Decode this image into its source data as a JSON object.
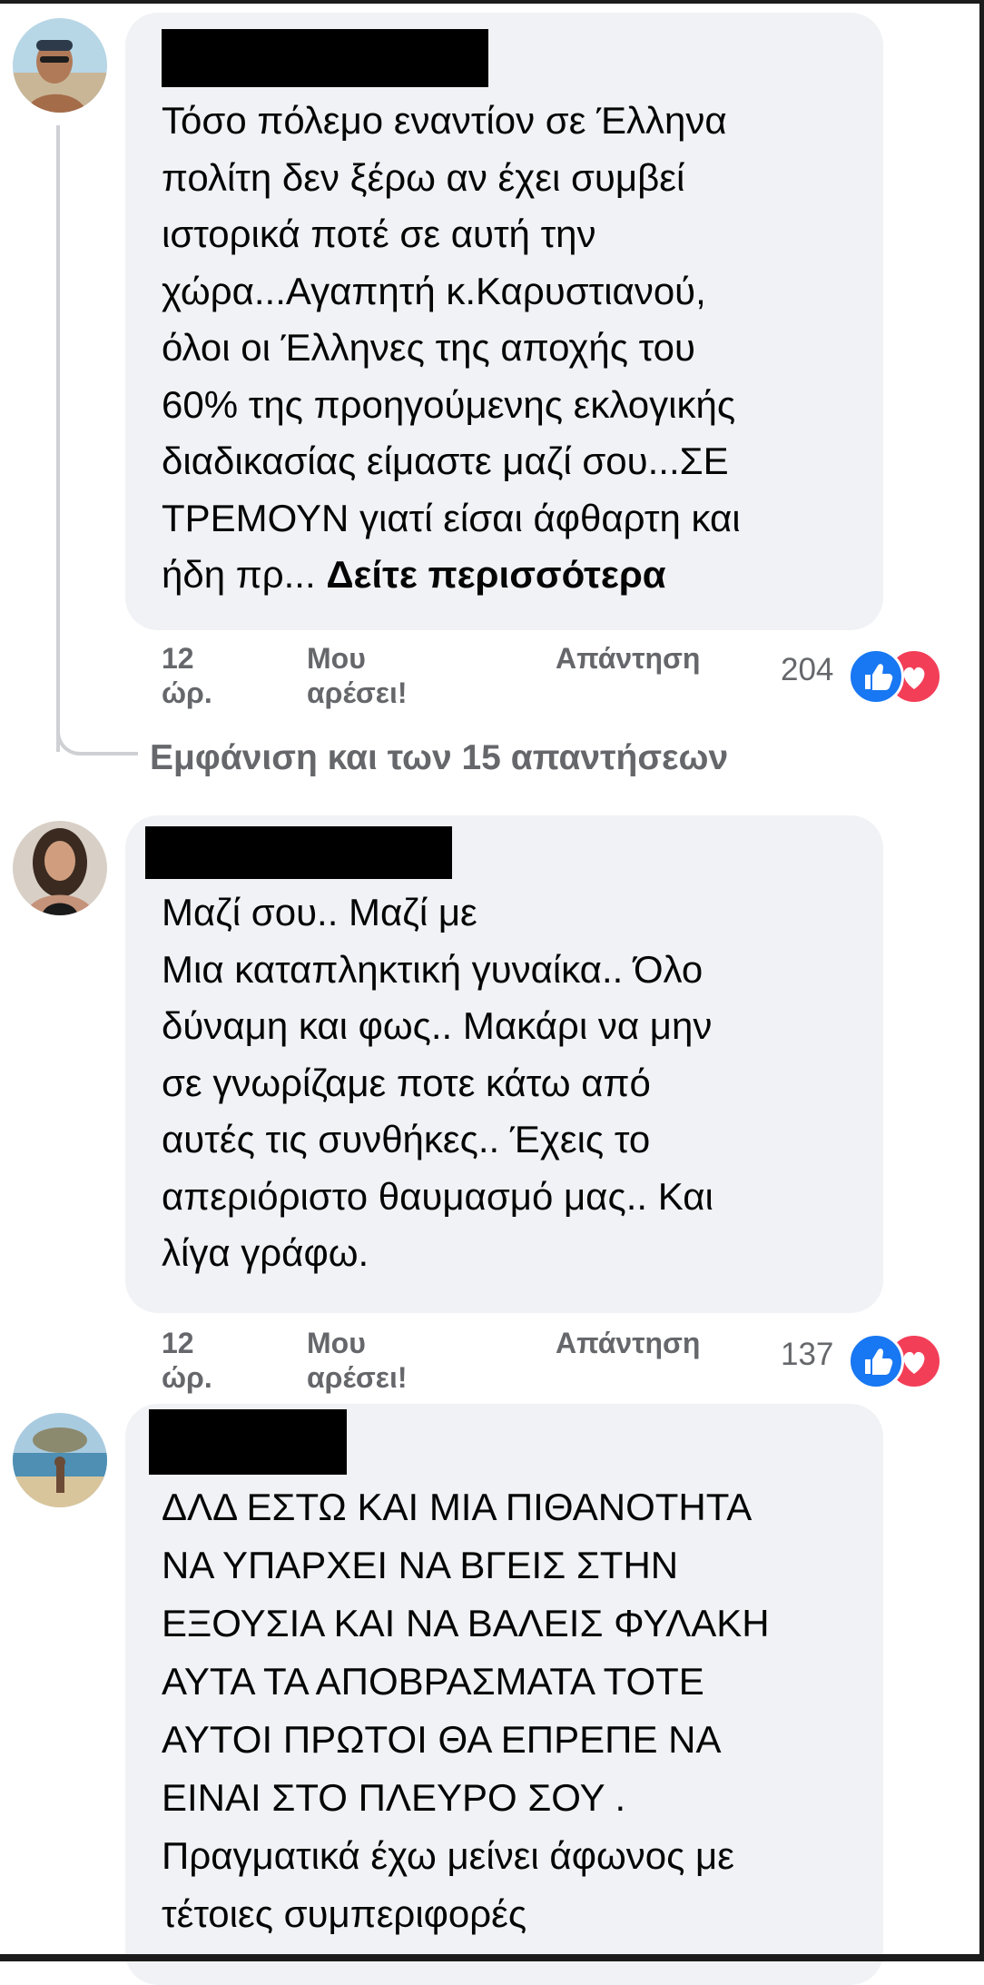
{
  "comments": [
    {
      "text": "Τόσο πόλεμο εναντίον σε Έλληνα\nπολίτη δεν ξέρω αν έχει συμβεί\nιστορικά ποτέ σε αυτή την\nχώρα...Αγαπητή κ.Καρυστιανού,\nόλοι οι Έλληνες της αποχής του\n60% της προηγούμενης εκλογικής\nδιαδικασίας είμαστε μαζί σου...ΣΕ\nΤΡΕΜΟΥΝ γιατί είσαι άφθαρτη και\nήδη πρ... ",
      "see_more": "Δείτε περισσότερα",
      "time": "12 ώρ.",
      "like_label": "Μου αρέσει!",
      "reply_label": "Απάντηση",
      "reaction_count": "204",
      "reactions": [
        "like-icon",
        "love-icon"
      ]
    },
    {
      "text": "Μαζί σου.. Μαζί με\nΜια καταπληκτική γυναίκα.. Όλο\nδύναμη και φως.. Μακάρι να μην\nσε γνωρίζαμε ποτε κάτω από\nαυτές τις συνθήκες.. Έχεις το\nαπεριόριστο θαυμασμό μας.. Και\nλίγα γράφω.",
      "time": "12 ώρ.",
      "like_label": "Μου αρέσει!",
      "reply_label": "Απάντηση",
      "reaction_count": "137",
      "reactions": [
        "like-icon",
        "love-icon"
      ]
    },
    {
      "text": "ΔΛΔ ΕΣΤΩ ΚΑΙ ΜΙΑ ΠΙΘΑΝΟΤΗΤΑ\nΝΑ ΥΠΑΡΧΕΙ ΝΑ ΒΓΕΙΣ ΣΤΗΝ\nΕΞΟΥΣΙΑ ΚΑΙ ΝΑ ΒΑΛΕΙΣ ΦΥΛΑΚΗ\nΑΥΤΑ ΤΑ ΑΠΟΒΡΑΣΜΑΤΑ ΤΟΤΕ\nΑΥΤΟΙ ΠΡΩΤΟΙ ΘΑ ΕΠΡΕΠΕ ΝΑ\nΕΙΝΑΙ ΣΤΟ ΠΛΕΥΡΟ ΣΟΥ .\nΠραγματικά έχω μείνει άφωνος με\nτέτοιες συμπεριφορές"
    }
  ],
  "view_replies_label": "Εμφάνιση και των 15 απαντήσεων",
  "colors": {
    "bubble": "#f0f2f5",
    "secondary_text": "#65676b",
    "like_blue": "#1877f2",
    "love_red": "#f33e58",
    "redaction": "#000000"
  }
}
